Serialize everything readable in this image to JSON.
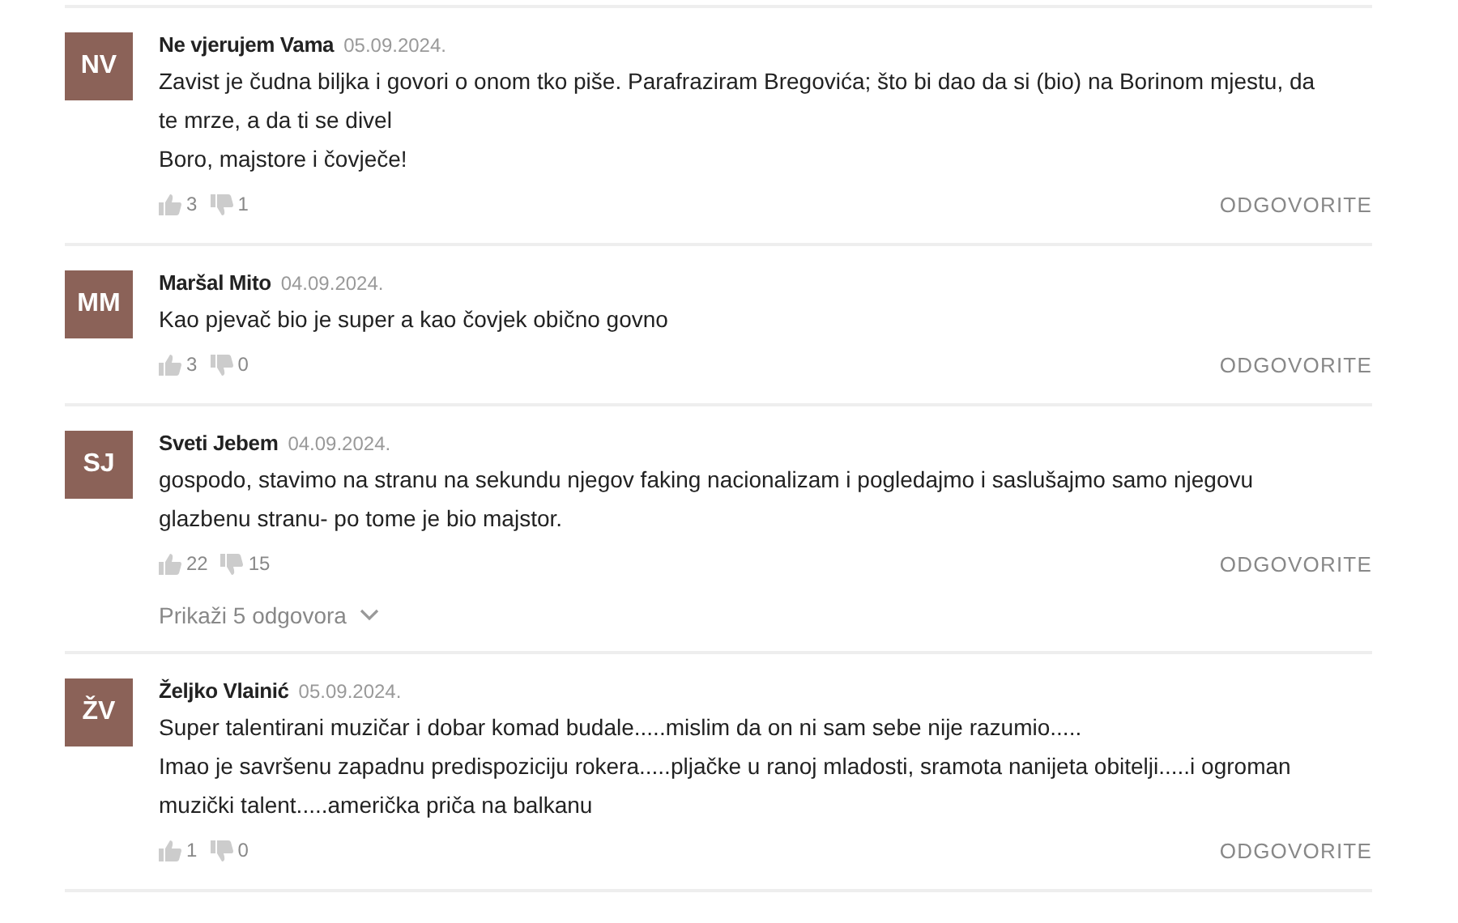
{
  "comments": [
    {
      "initials": "NV",
      "author": "Ne vjerujem Vama",
      "date": "05.09.2024.",
      "paragraphs": [
        "Zavist je čudna biljka i govori o onom tko piše. Parafraziram Bregovića; što bi dao da si (bio) na Borinom mjestu, da te mrze, a da ti se divel",
        "Boro, majstore i čovječe!"
      ],
      "likes": "3",
      "dislikes": "1",
      "reply": "ODGOVORITE"
    },
    {
      "initials": "MM",
      "author": "Maršal Mito",
      "date": "04.09.2024.",
      "paragraphs": [
        "Kao pjevač bio je super a kao čovjek obično govno"
      ],
      "likes": "3",
      "dislikes": "0",
      "reply": "ODGOVORITE"
    },
    {
      "initials": "SJ",
      "author": "Sveti Jebem",
      "date": "04.09.2024.",
      "paragraphs": [
        "gospodo, stavimo na stranu na sekundu njegov faking nacionalizam i pogledajmo i saslušajmo samo njegovu glazbenu stranu- po tome je bio majstor."
      ],
      "likes": "22",
      "dislikes": "15",
      "reply": "ODGOVORITE",
      "show_replies": "Prikaži 5 odgovora"
    },
    {
      "initials": "ŽV",
      "author": "Željko Vlainić",
      "date": "05.09.2024.",
      "paragraphs": [
        "Super talentirani muzičar i dobar komad budale.....mislim da on ni sam sebe nije razumio.....",
        "Imao je savršenu zapadnu predispoziciju rokera.....pljačke u ranoj mladosti, sramota nanijeta obitelji.....i ogroman muzički talent.....američka priča na balkanu"
      ],
      "likes": "1",
      "dislikes": "0",
      "reply": "ODGOVORITE"
    }
  ]
}
